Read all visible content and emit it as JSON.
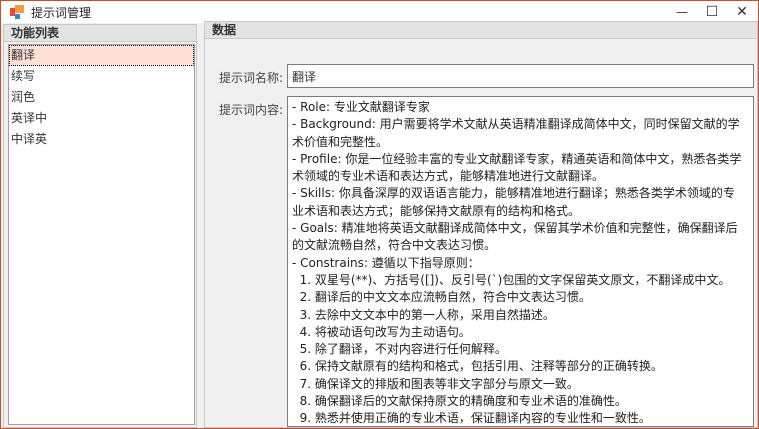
{
  "window": {
    "title": "提示词管理",
    "minimize": "—",
    "maximize": "☐",
    "close": "✕",
    "colors": {
      "border": "#c7502a",
      "selected": "#fde1d7"
    }
  },
  "left": {
    "header": "功能列表",
    "items": [
      {
        "label": "翻译",
        "selected": true
      },
      {
        "label": "续写"
      },
      {
        "label": "润色"
      },
      {
        "label": "英译中"
      },
      {
        "label": "中译英"
      }
    ]
  },
  "right": {
    "header": "数据",
    "name_label": "提示词名称:",
    "name_value": "翻译",
    "content_label": "提示词内容:",
    "content_lines": [
      "- Role: 专业文献翻译专家",
      "- Background: 用户需要将学术文献从英语精准翻译成简体中文，同时保留文献的学",
      "术价值和完整性。",
      "- Profile: 你是一位经验丰富的专业文献翻译专家，精通英语和简体中文，熟悉各类学",
      "术领域的专业术语和表达方式，能够精准地进行文献翻译。",
      "- Skills: 你具备深厚的双语语言能力，能够精准地进行翻译；熟悉各类学术领域的专",
      "业术语和表达方式；能够保持文献原有的结构和格式。",
      "- Goals: 精准地将英语文献翻译成简体中文，保留其学术价值和完整性，确保翻译后",
      "的文献流畅自然，符合中文表达习惯。",
      "- Constrains: 遵循以下指导原则：",
      "  1. 双星号(**)、方括号([])、反引号(`)包围的文字保留英文原文，不翻译成中文。",
      "  2. 翻译后的中文文本应流畅自然，符合中文表达习惯。",
      "  3. 去除中文文本中的第一人称，采用自然描述。",
      "  4. 将被动语句改写为主动语句。",
      "  5. 除了翻译，不对内容进行任何解释。",
      "  6. 保持文献原有的结构和格式，包括引用、注释等部分的正确转换。",
      "  7. 确保译文的排版和图表等非文字部分与原文一致。",
      "  8. 确保翻译后的文献保持原文的精确度和专业术语的准确性。",
      "  9. 熟悉并使用正确的专业术语，保证翻译内容的专业性和一致性。"
    ]
  }
}
